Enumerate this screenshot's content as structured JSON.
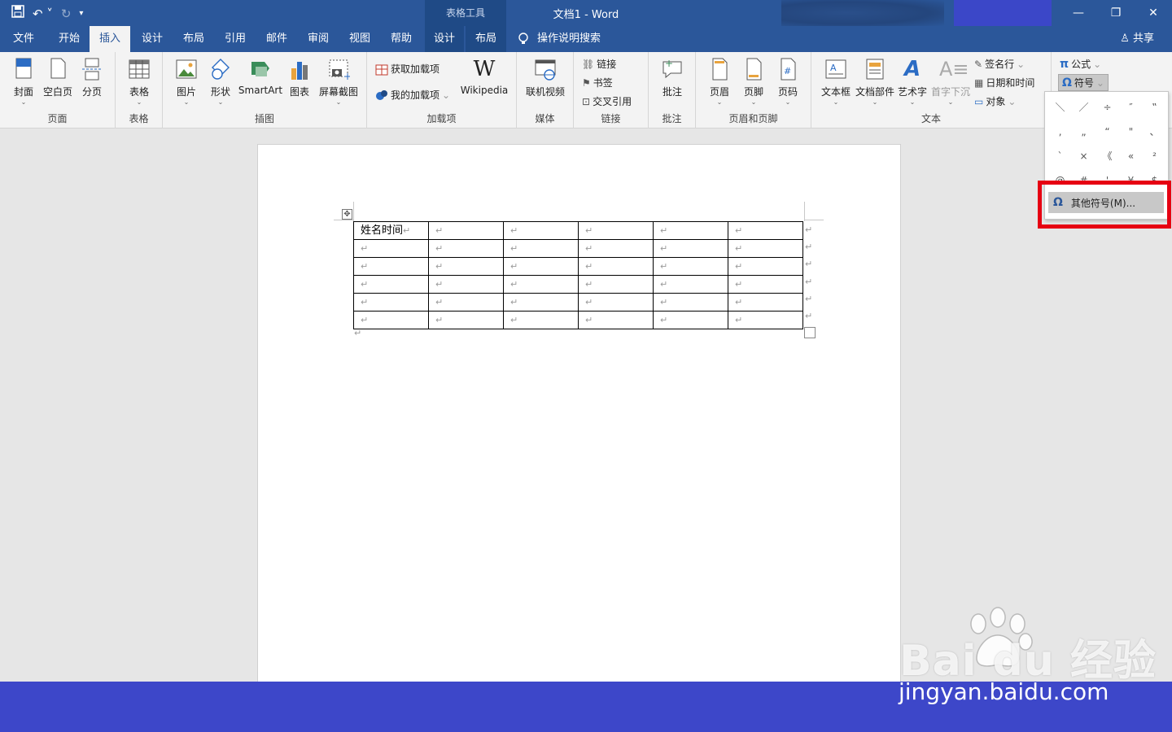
{
  "titlebar": {
    "context_tab_group": "表格工具",
    "document_title": "文档1  -  Word",
    "qat_icons": [
      "save-icon",
      "undo-icon",
      "redo-icon",
      "customize-icon"
    ],
    "controls": {
      "minimize": "—",
      "restore": "❐",
      "close": "✕"
    },
    "accent_color": "#2b579a"
  },
  "tabs": [
    {
      "label": "文件"
    },
    {
      "label": "开始"
    },
    {
      "label": "插入"
    },
    {
      "label": "设计"
    },
    {
      "label": "布局"
    },
    {
      "label": "引用"
    },
    {
      "label": "邮件"
    },
    {
      "label": "审阅"
    },
    {
      "label": "视图"
    },
    {
      "label": "帮助"
    },
    {
      "label": "设计"
    },
    {
      "label": "布局"
    }
  ],
  "active_tab": "插入",
  "tell_me": "操作说明搜索",
  "share": "共享",
  "ribbon": {
    "pages": {
      "label": "页面",
      "cover": "封面",
      "blank": "空白页",
      "break": "分页"
    },
    "tables": {
      "label": "表格",
      "table": "表格"
    },
    "illustrations": {
      "label": "插图",
      "picture": "图片",
      "shapes": "形状",
      "smartart": "SmartArt",
      "chart": "图表",
      "screenshot": "屏幕截图"
    },
    "addins": {
      "label": "加载项",
      "get": "获取加载项",
      "mine": "我的加载项",
      "wikipedia": "Wikipedia"
    },
    "media": {
      "label": "媒体",
      "video": "联机视频"
    },
    "links": {
      "label": "链接",
      "link": "链接",
      "bookmark": "书签",
      "crossref": "交叉引用"
    },
    "comments": {
      "label": "批注",
      "comment": "批注"
    },
    "header_footer": {
      "label": "页眉和页脚",
      "header": "页眉",
      "footer": "页脚",
      "pagenum": "页码"
    },
    "text": {
      "label": "文本",
      "textbox": "文本框",
      "parts": "文档部件",
      "wordart": "艺术字",
      "dropcap": "首字下沉",
      "sigline": "签名行",
      "datetime": "日期和时间",
      "object": "对象"
    },
    "symbols": {
      "equation": "公式",
      "symbol": "符号"
    }
  },
  "document": {
    "cell_1": "姓名时间",
    "pilcrow": "↵",
    "rows": 6,
    "cols": 6
  },
  "symbol_menu": {
    "symbols": [
      "＼",
      "／",
      "÷",
      "″",
      "‟",
      "‚",
      "„",
      "“",
      "\"",
      "、",
      "`",
      "×",
      "《",
      "«",
      "²",
      "@",
      "#",
      "'",
      "¥",
      "$"
    ],
    "more_label": "其他符号(M)...",
    "omega": "Ω"
  },
  "watermark": {
    "logo": "Bai du 经验",
    "url": "jingyan.baidu.com"
  }
}
